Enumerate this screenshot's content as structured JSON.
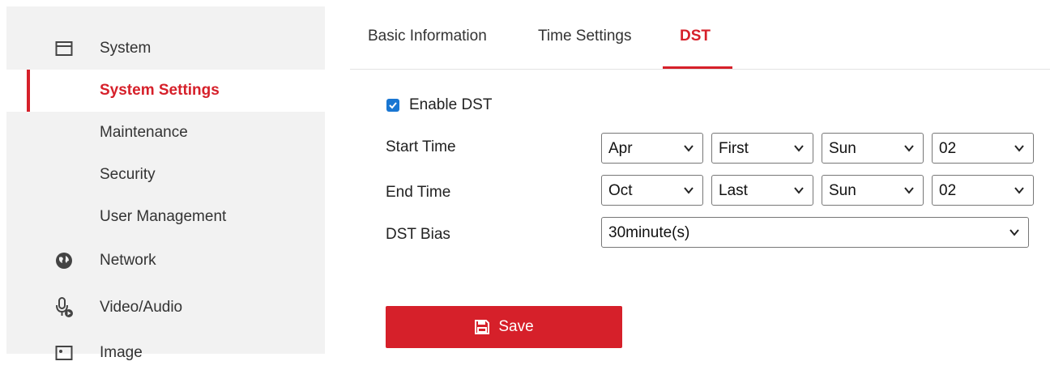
{
  "sidebar": {
    "items": [
      {
        "label": "System",
        "icon": "window-icon"
      },
      {
        "label": "System Settings"
      },
      {
        "label": "Maintenance"
      },
      {
        "label": "Security"
      },
      {
        "label": "User Management"
      },
      {
        "label": "Network",
        "icon": "globe-icon"
      },
      {
        "label": "Video/Audio",
        "icon": "microphone-icon"
      },
      {
        "label": "Image",
        "icon": "image-icon"
      }
    ]
  },
  "tabs": [
    {
      "label": "Basic Information"
    },
    {
      "label": "Time Settings"
    },
    {
      "label": "DST"
    }
  ],
  "form": {
    "enable_dst": {
      "label": "Enable DST",
      "checked": true
    },
    "start_time": {
      "label": "Start Time",
      "month": "Apr",
      "week": "First",
      "day": "Sun",
      "hour": "02"
    },
    "end_time": {
      "label": "End Time",
      "month": "Oct",
      "week": "Last",
      "day": "Sun",
      "hour": "02"
    },
    "dst_bias": {
      "label": "DST Bias",
      "value": "30minute(s)"
    }
  },
  "save_label": "Save",
  "colors": {
    "accent": "#d6202a",
    "checkbox": "#1976d2"
  }
}
